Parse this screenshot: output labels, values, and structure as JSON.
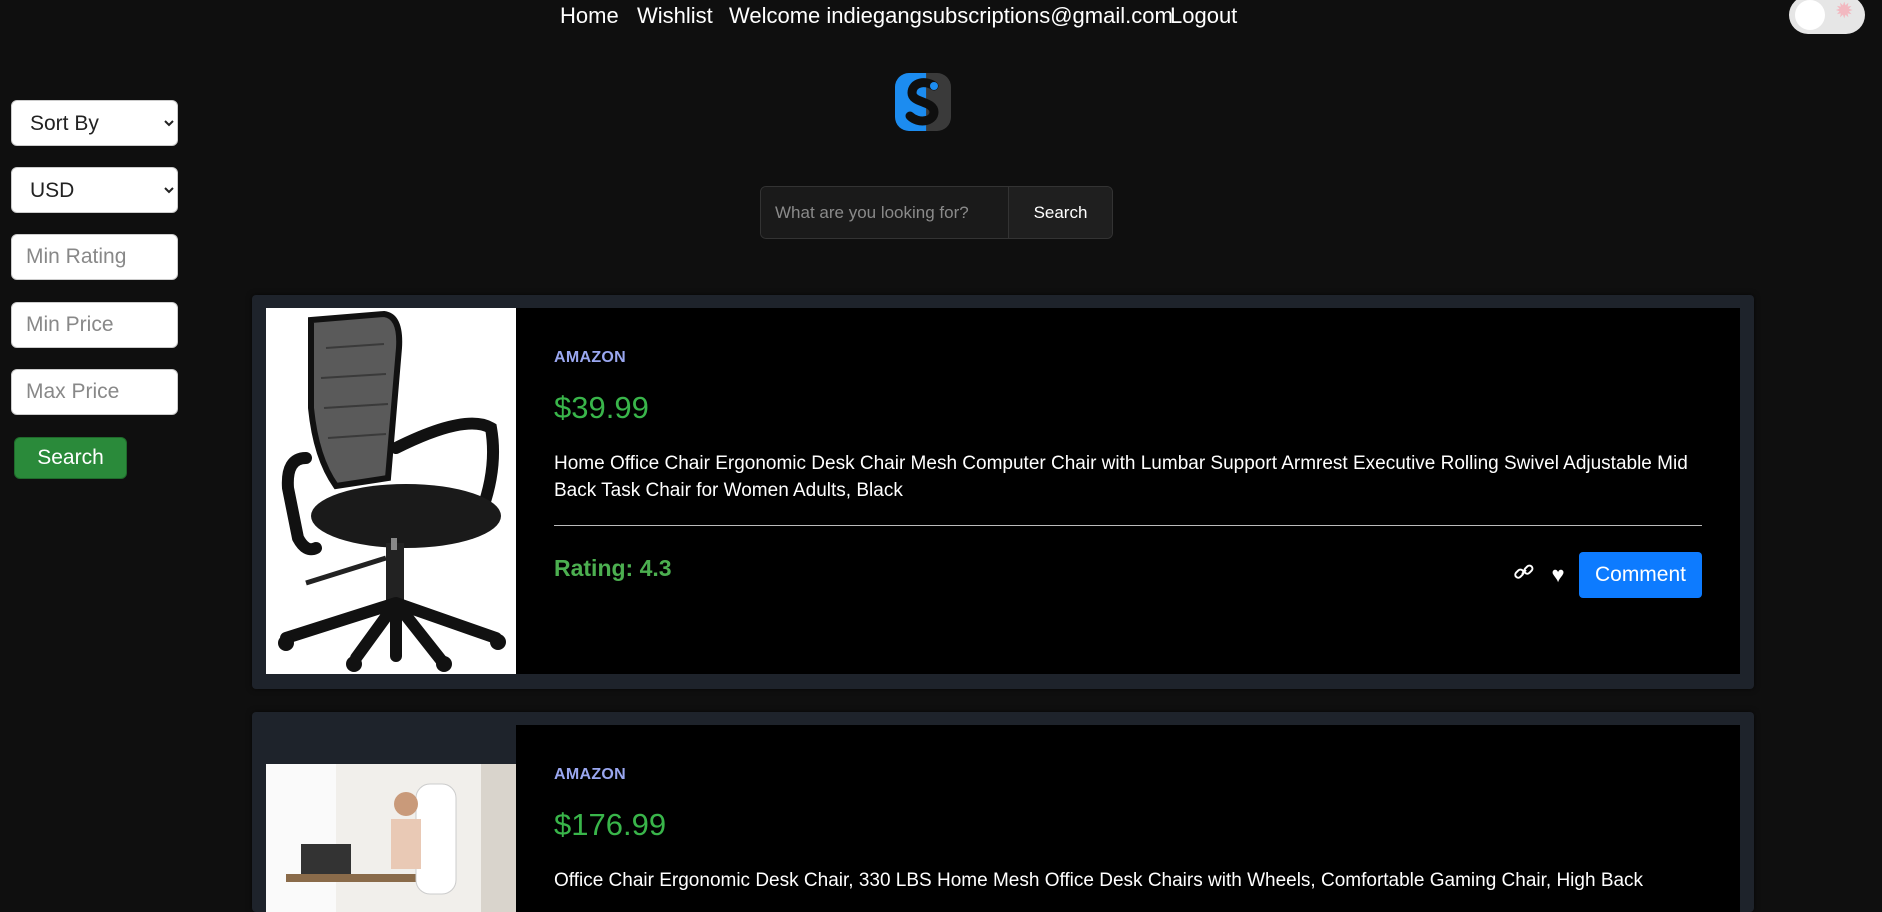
{
  "nav": {
    "home": "Home",
    "wishlist": "Wishlist",
    "welcome": "Welcome indiegangsubscriptions@gmail.com",
    "logout": "Logout"
  },
  "search": {
    "placeholder": "What are you looking for?",
    "button": "Search"
  },
  "filters": {
    "sort_by": "Sort By",
    "currency": "USD",
    "min_rating_placeholder": "Min Rating",
    "min_price_placeholder": "Min Price",
    "max_price_placeholder": "Max Price",
    "search_button": "Search"
  },
  "products": [
    {
      "store": "AMAZON",
      "price": "$39.99",
      "title": "Home Office Chair Ergonomic Desk Chair Mesh Computer Chair with Lumbar Support Armrest Executive Rolling Swivel Adjustable Mid Back Task Chair for Women Adults, Black",
      "rating": "Rating: 4.3",
      "comment_label": "Comment"
    },
    {
      "store": "AMAZON",
      "price": "$176.99",
      "title": "Office Chair Ergonomic Desk Chair, 330 LBS Home Mesh Office Desk Chairs with Wheels, Comfortable Gaming Chair, High Back"
    }
  ],
  "colors": {
    "accent_green": "#39b54a",
    "store_label": "#9aa7f0",
    "comment_blue": "#0d7bff"
  }
}
